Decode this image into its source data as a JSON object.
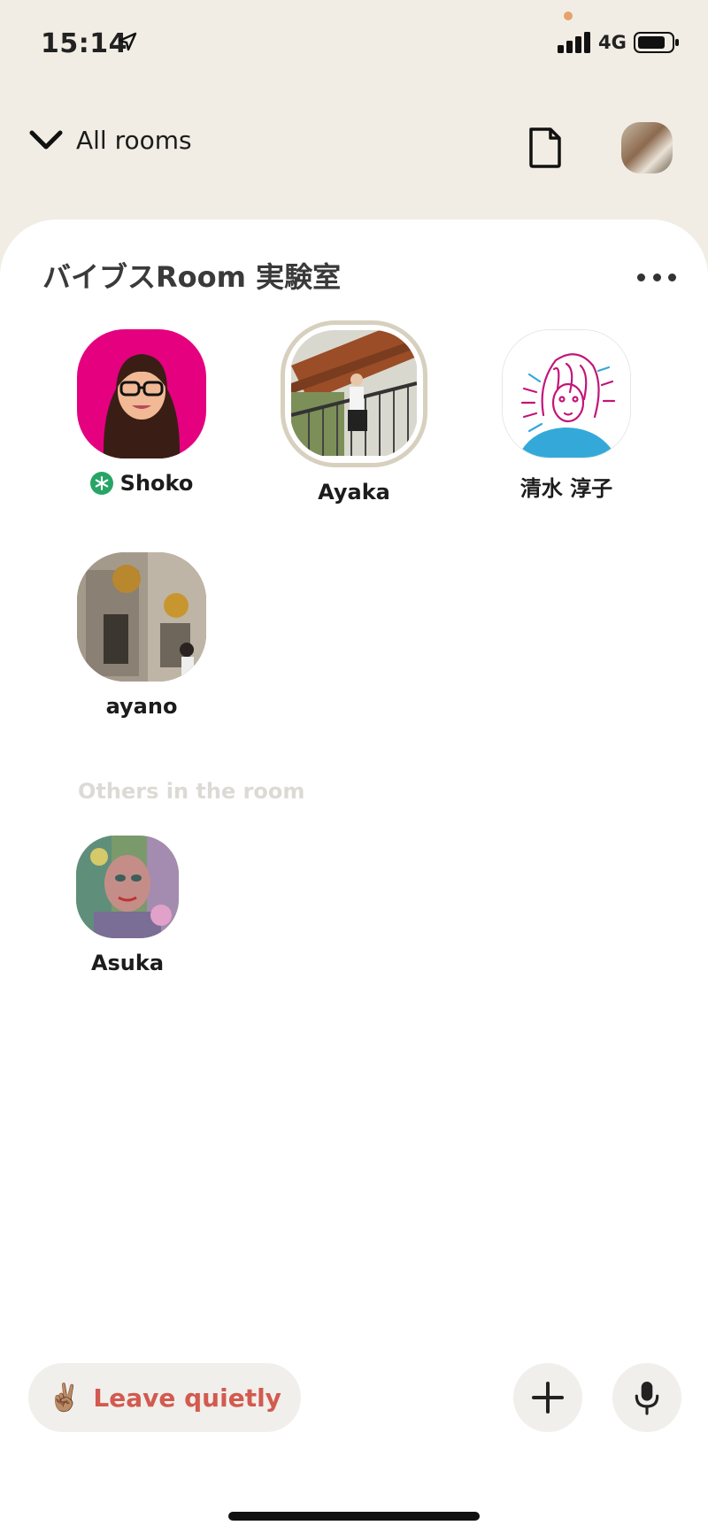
{
  "status_bar": {
    "time": "15:14",
    "network": "4G",
    "icons": [
      "location-arrow-icon",
      "signal-icon",
      "battery-icon"
    ]
  },
  "header": {
    "nav_label": "All rooms",
    "icons": [
      "chevron-down-icon",
      "document-icon",
      "profile-avatar"
    ]
  },
  "room": {
    "title": "バイブスRoom 実験室",
    "speakers": [
      {
        "name": "Shoko",
        "moderator": true
      },
      {
        "name": "Ayaka",
        "speaking": true
      },
      {
        "name": "清水 淳子"
      },
      {
        "name": "ayano"
      }
    ],
    "others_label": "Others in the room",
    "others": [
      {
        "name": "Asuka"
      }
    ]
  },
  "footer": {
    "leave_emoji": "✌🏽",
    "leave_label": "Leave quietly",
    "icons": [
      "plus-icon",
      "microphone-icon"
    ]
  },
  "colors": {
    "background": "#f1ede4",
    "leave_text": "#d25a4f",
    "moderator_badge": "#27a566"
  }
}
